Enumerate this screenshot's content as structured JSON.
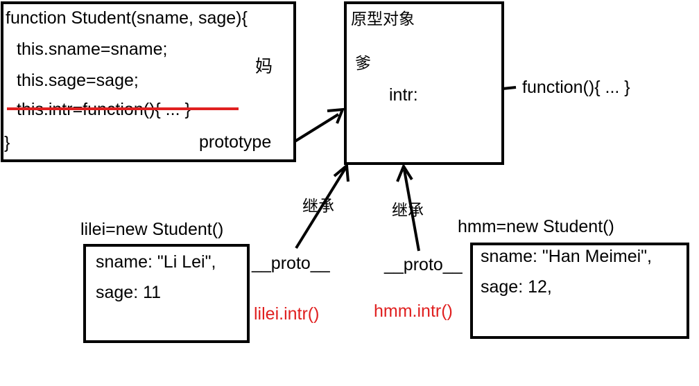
{
  "constructor_box": {
    "line1": "function Student(sname, sage){",
    "line2": "this.sname=sname;",
    "line3": "this.sage=sage;",
    "line4_struck": "this.intr=function(){ ... }",
    "line5": "}",
    "mother_label": "妈",
    "prototype_label": "prototype"
  },
  "prototype_box": {
    "title": "原型对象",
    "father_label": "爹",
    "intr_label": "intr:",
    "function_label": "function(){ ... }"
  },
  "lilei": {
    "heading": "lilei=new Student()",
    "line1": "sname: \"Li Lei\",",
    "line2": "sage: 11",
    "proto_label": "__proto__",
    "inherit_label": "继承",
    "call": "lilei.intr()"
  },
  "hmm": {
    "heading": "hmm=new Student()",
    "line1": "sname: \"Han Meimei\",",
    "line2": "sage: 12,",
    "proto_label": "__proto__",
    "inherit_label": "继承",
    "call": "hmm.intr()"
  },
  "colors": {
    "stroke": "#000000",
    "accent_red": "#e02020"
  }
}
